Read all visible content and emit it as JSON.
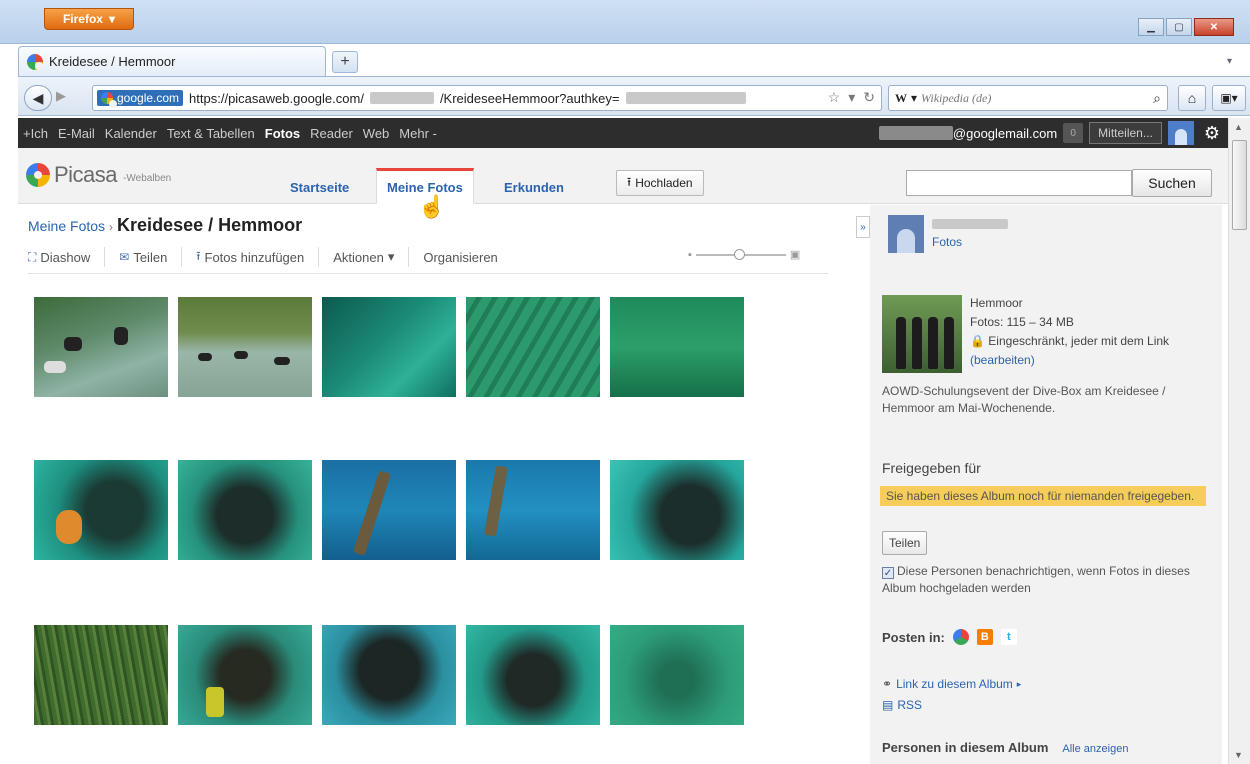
{
  "browser": {
    "menu_button": "Firefox",
    "tab_title": "Kreidesee / Hemmoor",
    "site_identity": "google.com",
    "url_prefix": "https://picasaweb.google.com/",
    "url_mid": "/KreideseeHemmoor?authkey=",
    "search_engine": "W",
    "search_placeholder": "Wikipedia (de)"
  },
  "gbar": {
    "items": [
      "+Ich",
      "E-Mail",
      "Kalender",
      "Text & Tabellen",
      "Fotos",
      "Reader",
      "Web",
      "Mehr -"
    ],
    "active_index": 4,
    "email_domain": "@googlemail.com",
    "notification_count": "0",
    "share_label": "Mitteilen..."
  },
  "picasa": {
    "logo": "Picasa",
    "logo_sub": "-Webalben",
    "tabs": [
      "Startseite",
      "Meine Fotos",
      "Erkunden"
    ],
    "active_tab": 1,
    "upload_label": "Hochladen",
    "search_button": "Suchen"
  },
  "album": {
    "breadcrumb_link": "Meine Fotos",
    "breadcrumb_sep": "›",
    "title": "Kreidesee / Hemmoor",
    "toolbar": {
      "slideshow": "Diashow",
      "share": "Teilen",
      "add_photos": "Fotos hinzufügen",
      "actions": "Aktionen",
      "organize": "Organisieren"
    },
    "photo_count_visible": 15
  },
  "sidebar": {
    "collapse": "»",
    "owner_link": "Fotos",
    "album_name": "Hemmoor",
    "album_stats": "Fotos: 115 – 34 MB",
    "visibility": "Eingeschränkt, jeder mit dem Link",
    "edit_link": "(bearbeiten)",
    "description": "AOWD-Schulungsevent der Dive-Box am Kreidesee / Hemmoor am Mai-Wochenende.",
    "shared_title": "Freigegeben für",
    "shared_warning": "Sie haben dieses Album noch für niemanden freigegeben.",
    "share_button": "Teilen",
    "notify_text": "Diese Personen benachrichtigen, wenn Fotos in dieses Album hochgeladen werden",
    "post_label": "Posten in:",
    "link_label": "Link zu diesem Album",
    "rss_label": "RSS",
    "persons_title": "Personen in diesem Album",
    "persons_link": "Alle anzeigen"
  },
  "colors": {
    "accent_link": "#2b63b0",
    "gbar_bg": "#2d2d2d",
    "warning_bg": "#f6cd5b",
    "firefox_orange": "#e06b12"
  }
}
